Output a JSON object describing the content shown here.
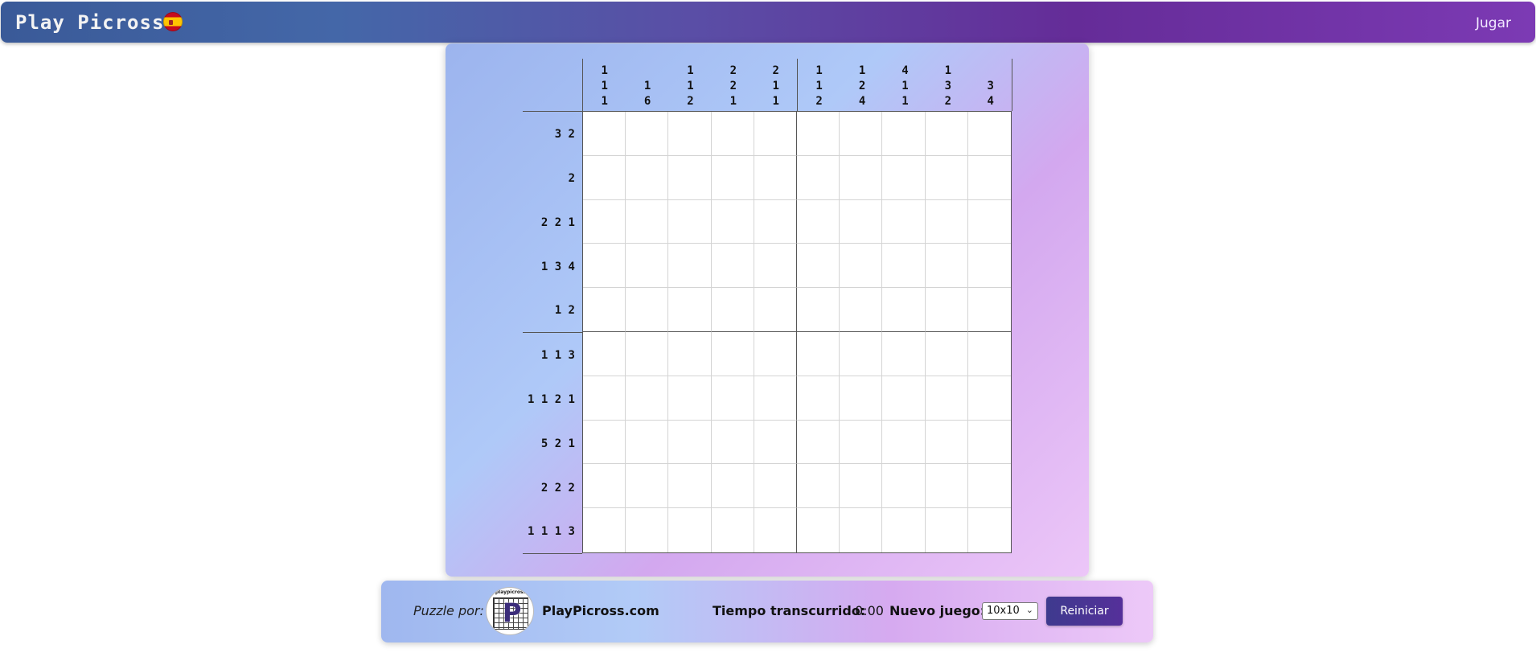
{
  "header": {
    "brand": "Play Picross",
    "flag_icon": "spain-flag-icon",
    "play_label": "Jugar"
  },
  "puzzle": {
    "size": "10x10",
    "column_clues": [
      [
        "1",
        "1",
        "1"
      ],
      [
        "1",
        "6"
      ],
      [
        "1",
        "1",
        "2"
      ],
      [
        "2",
        "2",
        "1"
      ],
      [
        "2",
        "1",
        "1"
      ],
      [
        "1",
        "1",
        "2"
      ],
      [
        "1",
        "2",
        "4"
      ],
      [
        "4",
        "1",
        "1"
      ],
      [
        "1",
        "3",
        "2"
      ],
      [
        "3",
        "4"
      ]
    ],
    "row_clues": [
      "3 2",
      "2",
      "2 2 1",
      "1 3 4",
      "1 2",
      "1 1 3",
      "1 1 2 1",
      "5 2 1",
      "2 2 2",
      "1 1 1 3"
    ]
  },
  "footer": {
    "puzzle_by_label": "Puzzle por:",
    "logo_text": "playpicross",
    "logo_letter": "P",
    "site_name": "PlayPicross.com",
    "elapsed_label": "Tiempo transcurrido:",
    "elapsed_value": "0:00",
    "new_game_label": "Nuevo juego:",
    "size_selected": "10x10",
    "reset_label": "Reiniciar"
  },
  "colors": {
    "header_start": "#3a5a98",
    "header_end": "#7c3ab4",
    "button": "#46378f"
  }
}
